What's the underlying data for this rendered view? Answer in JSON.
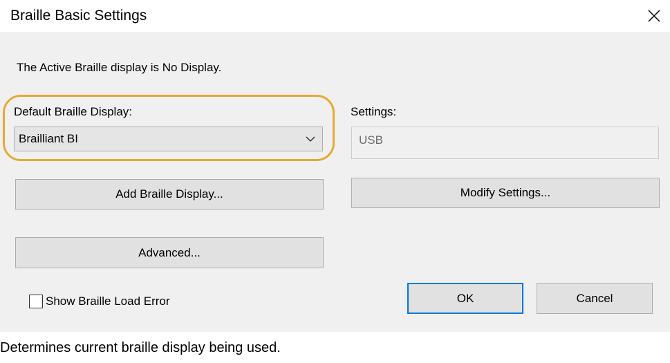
{
  "window": {
    "title": "Braille Basic Settings"
  },
  "dialog": {
    "active_display_text": "The Active Braille display is No Display.",
    "default_display_label": "Default Braille Display:",
    "default_display_value": "Brailliant BI",
    "settings_label": "Settings:",
    "settings_value": "USB",
    "add_button_label": "Add Braille Display...",
    "modify_button_label": "Modify Settings...",
    "advanced_button_label": "Advanced...",
    "checkbox_label": "Show Braille Load Error",
    "checkbox_checked": false,
    "ok_label": "OK",
    "cancel_label": "Cancel"
  },
  "status": {
    "text": "Determines current braille display being used."
  },
  "icons": {
    "close": "close-icon",
    "dropdown": "chevron-down-icon"
  },
  "colors": {
    "highlight": "#e8a735",
    "default_button_border": "#0078d7",
    "client_background": "#f0f0f0"
  }
}
